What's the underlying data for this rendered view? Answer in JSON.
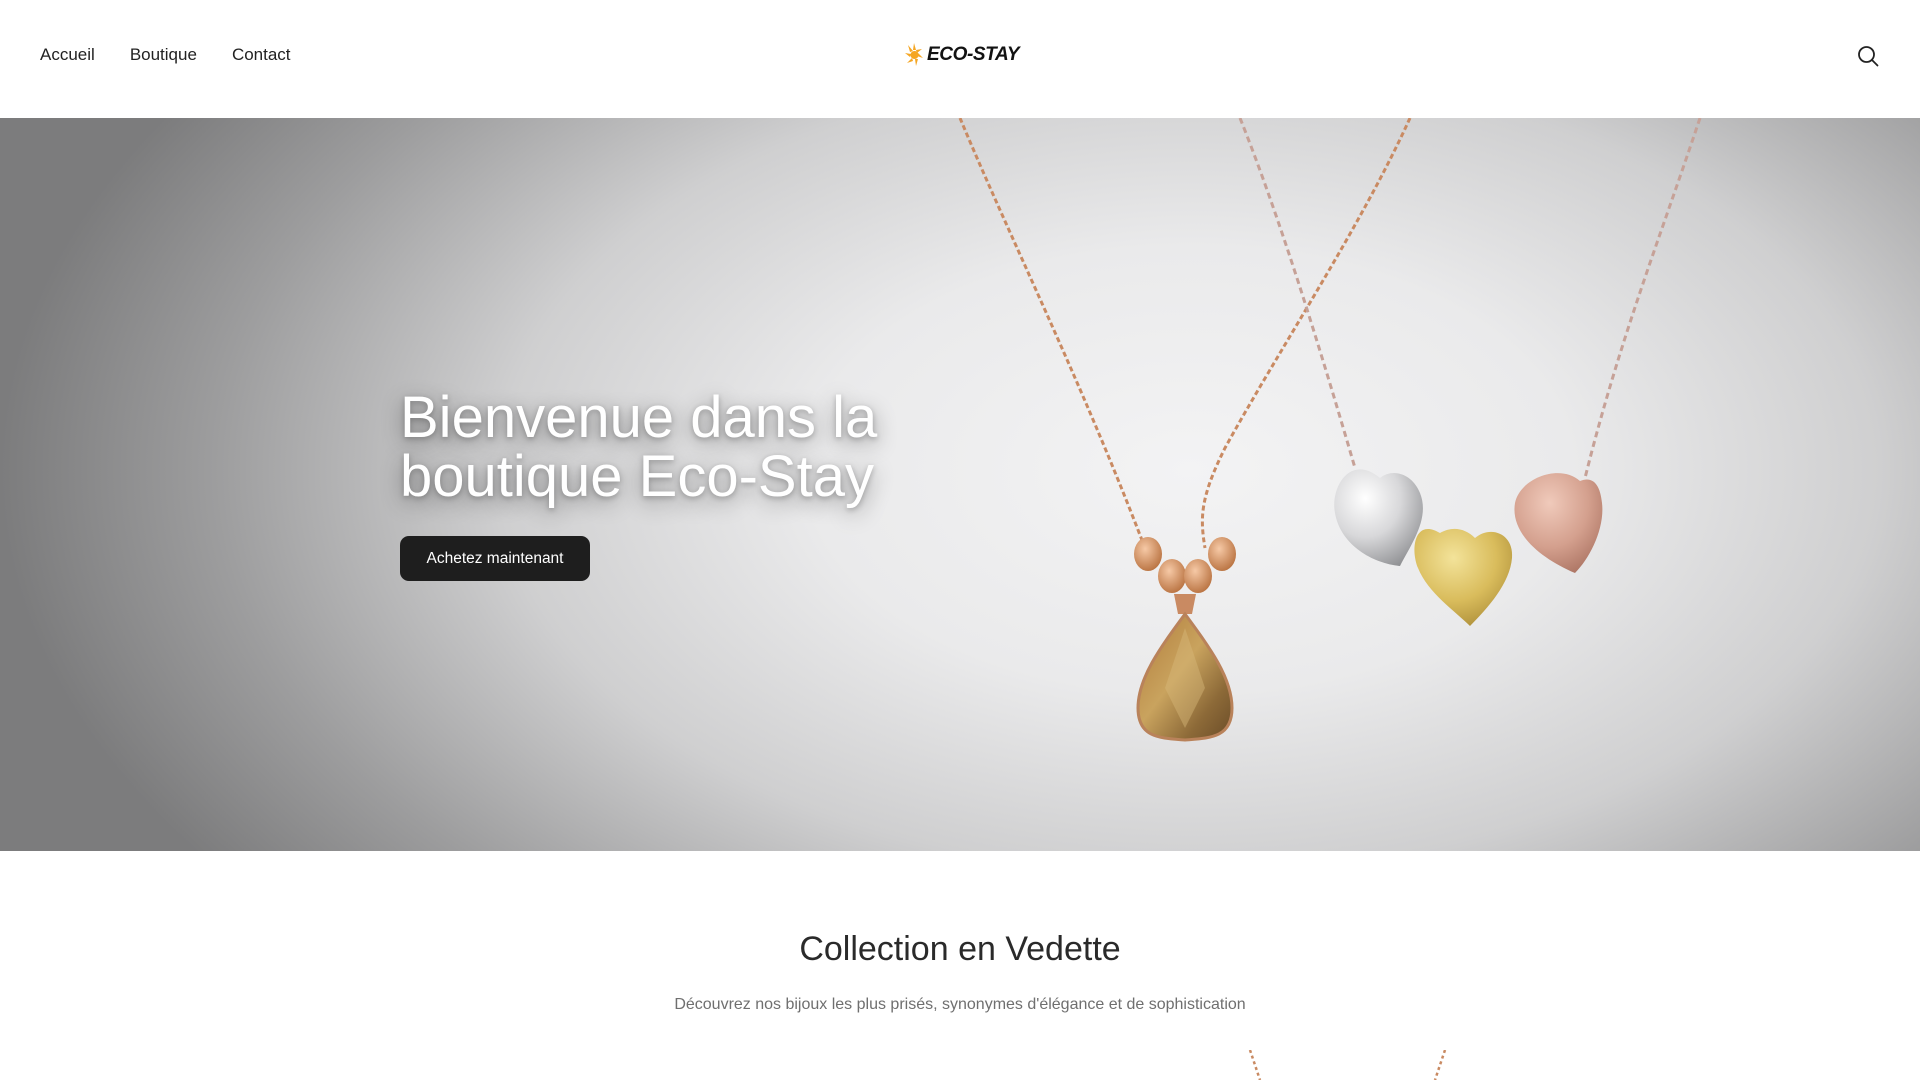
{
  "header": {
    "nav": [
      {
        "label": "Accueil"
      },
      {
        "label": "Boutique"
      },
      {
        "label": "Contact"
      }
    ],
    "logo_text": "ECO-STAY",
    "search_icon": "search-icon"
  },
  "hero": {
    "title_line1": "Bienvenue dans la",
    "title_line2": "boutique Eco-Stay",
    "cta_label": "Achetez maintenant"
  },
  "featured": {
    "title": "Collection en Vedette",
    "subtitle": "Découvrez nos bijoux les plus prisés, synonymes d'élégance et de sophistication"
  },
  "colors": {
    "logo_accent": "#f5a623",
    "button_bg": "#1e1e1e",
    "rose_gold": "#c98a62"
  }
}
